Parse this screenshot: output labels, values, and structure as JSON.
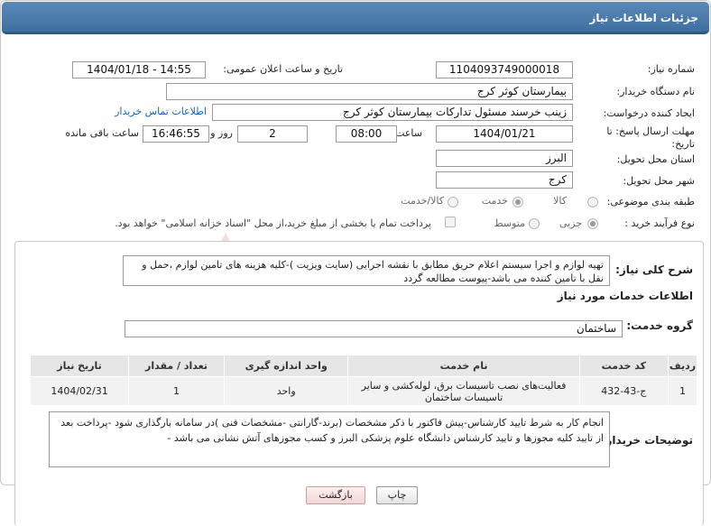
{
  "title": "جزئیات اطلاعات نیاز",
  "fields": {
    "need_number_label": "شماره نیاز:",
    "need_number": "1104093749000018",
    "announce_label": "تاریخ و ساعت اعلان عمومی:",
    "announce_value": "1404/01/18 - 14:55",
    "buyer_org_label": "نام دستگاه خریدار:",
    "buyer_org": "بیمارستان کوثر کرج",
    "creator_label": "ایجاد کننده درخواست:",
    "creator": "زینب خرسند مسئول تدارکات بیمارستان کوثر کرج",
    "contact_link": "اطلاعات تماس خریدار",
    "deadline_label": "مهلت ارسال پاسخ: تا تاریخ:",
    "deadline_date": "1404/01/21",
    "time_label": "ساعت",
    "deadline_time": "08:00",
    "days_value": "2",
    "days_label": "روز و",
    "remaining_time": "16:46:55",
    "remaining_label": "ساعت باقی مانده",
    "province_label": "استان محل تحویل:",
    "province": "البرز",
    "city_label": "شهر محل تحویل:",
    "city": "کرج",
    "category_label": "طبقه بندی موضوعی:",
    "category_options": [
      "کالا",
      "خدمت",
      "کالا/خدمت"
    ],
    "category_selected": "خدمت",
    "process_label": "نوع فرآیند خرید :",
    "process_options": [
      "جزیی",
      "متوسط"
    ],
    "process_selected": "جزیی",
    "payment_note": "پرداخت تمام یا بخشی از مبلغ خرید،از محل \"اسناد خزانه اسلامی\" خواهد بود."
  },
  "summary": {
    "label": "شرح کلی نیاز:",
    "text": "تهیه لوازم و اجرا سیستم اعلام حریق مطابق با نقشه اجرایی (سایت ویزیت )-کلیه هزینه های تامین لوازم ،حمل و نقل با  تامین کننده می باشد-پیوست مطالعه گردد"
  },
  "services": {
    "heading": "اطلاعات خدمات مورد نیاز",
    "group_label": "گروه خدمت:",
    "group_value": "ساختمان",
    "columns": [
      "ردیف",
      "کد خدمت",
      "نام خدمت",
      "واحد اندازه گیری",
      "تعداد / مقدار",
      "تاریخ نیاز"
    ],
    "rows": [
      {
        "index": "1",
        "code": "ج-43-432",
        "name": "فعالیت‌های نصب تاسیسات برق، لوله‌کشی و سایر تاسیسات ساختمان",
        "unit": "واحد",
        "qty": "1",
        "date": "1404/02/31"
      }
    ]
  },
  "buyer_notes": {
    "label": "توضیحات خریدار:",
    "text": "انجام کار  به شرط تایید کارشناس-پیش فاکتور با ذکر مشخصات (برند-گارانتی -مشخصات فنی )در سامانه بارگذاری شود -پرداخت بعد از  تایید کلیه مجوزها و تایید کارشناس  دانشگاه علوم پزشکی البرز و کسب مجوزهای آتش نشانی می باشد -"
  },
  "buttons": {
    "print": "چاپ",
    "back": "بازگشت"
  },
  "colors": {
    "title_bar": "#3f6f9f",
    "link": "#1565c0",
    "watermark": "#c0392b"
  }
}
